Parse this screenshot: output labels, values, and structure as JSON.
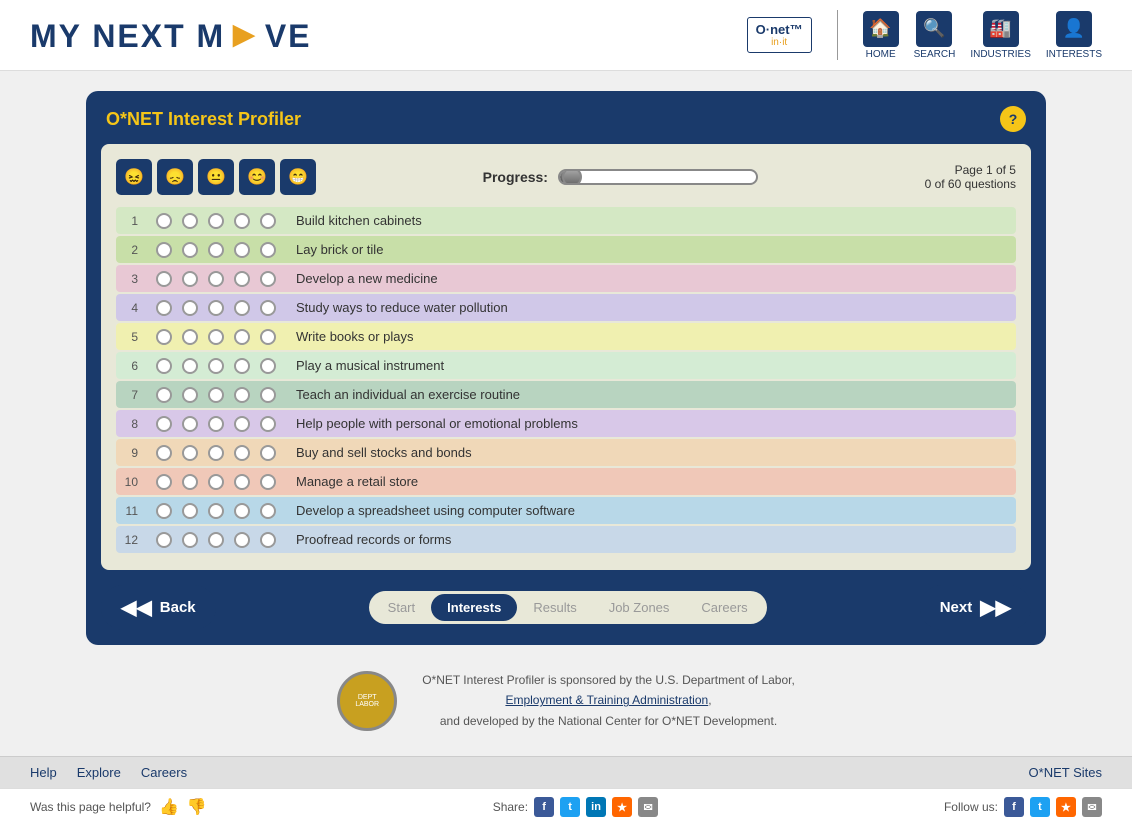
{
  "header": {
    "logo_text_1": "MY NEXT M",
    "logo_text_2": "VE",
    "logo_arrow": "◄",
    "onet_line1": "O·net™",
    "onet_line2": "in·it",
    "nav_items": [
      {
        "label": "HOME",
        "icon": "🏠"
      },
      {
        "label": "SEARCH",
        "icon": "🔍"
      },
      {
        "label": "INDUSTRIES",
        "icon": "🏭"
      },
      {
        "label": "INTERESTS",
        "icon": "👤"
      }
    ]
  },
  "profiler": {
    "title": "O*NET Interest Profiler",
    "help_label": "?",
    "progress_label": "Progress:",
    "page_info_line1": "Page 1 of 5",
    "page_info_line2": "0 of 60 questions",
    "emojis": [
      "😖",
      "😞",
      "😐",
      "😊",
      "😁"
    ]
  },
  "questions": [
    {
      "num": 1,
      "text": "Build kitchen cabinets",
      "color_class": "row-color-1"
    },
    {
      "num": 2,
      "text": "Lay brick or tile",
      "color_class": "row-color-2"
    },
    {
      "num": 3,
      "text": "Develop a new medicine",
      "color_class": "row-color-3"
    },
    {
      "num": 4,
      "text": "Study ways to reduce water pollution",
      "color_class": "row-color-4"
    },
    {
      "num": 5,
      "text": "Write books or plays",
      "color_class": "row-color-5"
    },
    {
      "num": 6,
      "text": "Play a musical instrument",
      "color_class": "row-color-6"
    },
    {
      "num": 7,
      "text": "Teach an individual an exercise routine",
      "color_class": "row-color-7"
    },
    {
      "num": 8,
      "text": "Help people with personal or emotional problems",
      "color_class": "row-color-8"
    },
    {
      "num": 9,
      "text": "Buy and sell stocks and bonds",
      "color_class": "row-color-9"
    },
    {
      "num": 10,
      "text": "Manage a retail store",
      "color_class": "row-color-10"
    },
    {
      "num": 11,
      "text": "Develop a spreadsheet using computer software",
      "color_class": "row-color-11"
    },
    {
      "num": 12,
      "text": "Proofread records or forms",
      "color_class": "row-color-12"
    }
  ],
  "nav": {
    "back_label": "Back",
    "next_label": "Next",
    "steps": [
      {
        "label": "Start",
        "active": false
      },
      {
        "label": "Interests",
        "active": true
      },
      {
        "label": "Results",
        "active": false
      },
      {
        "label": "Job Zones",
        "active": false
      },
      {
        "label": "Careers",
        "active": false
      }
    ]
  },
  "sponsor": {
    "text1": "O*NET Interest Profiler is sponsored by the U.S. Department of Labor,",
    "link_text": "Employment & Training Administration",
    "text2": "and developed by the National Center for O*NET Development."
  },
  "footer_nav": {
    "links": [
      "Help",
      "Explore",
      "Careers"
    ],
    "right_link": "O*NET Sites"
  },
  "footer_bottom": {
    "helpful_text": "Was this page helpful?",
    "share_text": "Share:",
    "follow_text": "Follow us:"
  }
}
